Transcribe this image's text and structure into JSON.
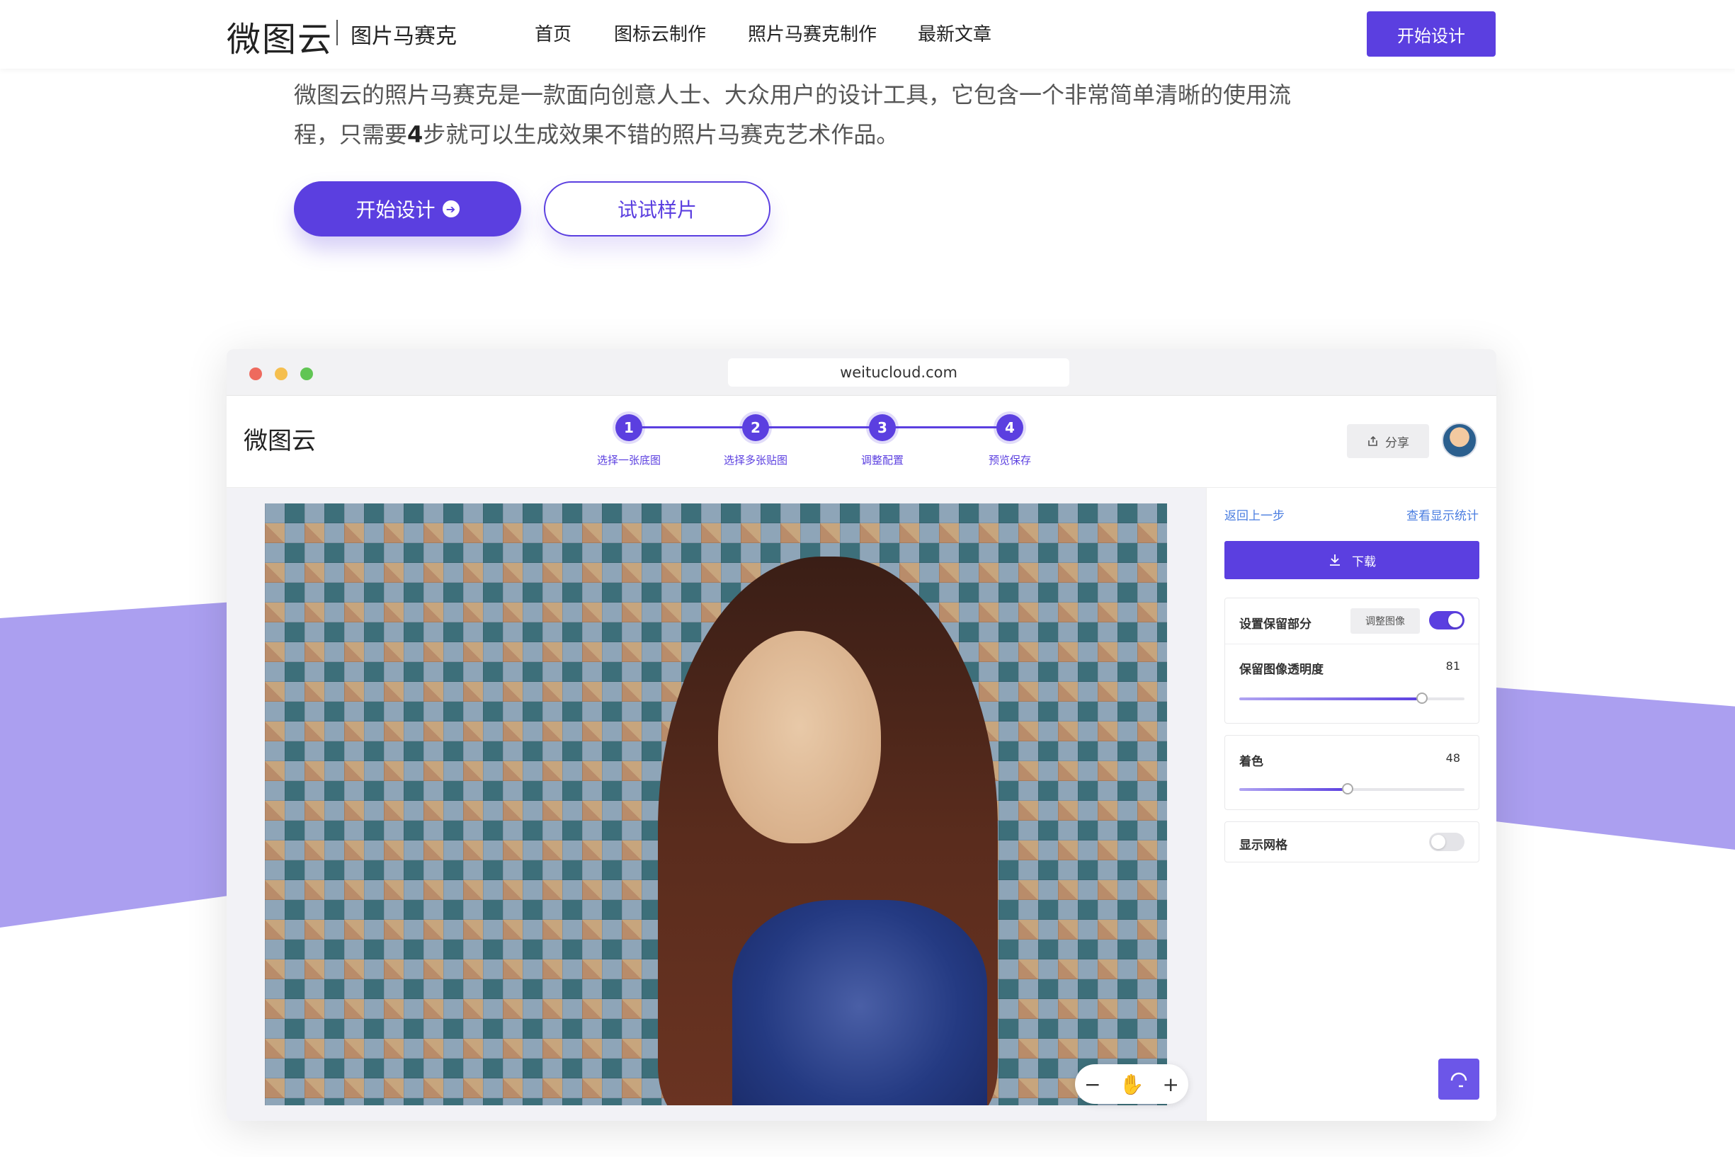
{
  "nav": {
    "brand": "微图云",
    "sub_brand": "图片马赛克",
    "links": [
      "首页",
      "图标云制作",
      "照片马赛克制作",
      "最新文章"
    ],
    "cta": "开始设计"
  },
  "hero": {
    "desc_part1": "微图云的照片马赛克是一款面向创意人士、大众用户的设计工具，它包含一个非常简单清晰的使用流程，只需要",
    "desc_bold": "4",
    "desc_part2": "步就可以生成效果不错的照片马赛克艺术作品。",
    "primary_button": "开始设计",
    "secondary_button": "试试样片"
  },
  "browser": {
    "url": "weitucloud.com",
    "app_logo": "微图云",
    "steps": [
      {
        "num": "1",
        "label": "选择一张底图"
      },
      {
        "num": "2",
        "label": "选择多张贴图"
      },
      {
        "num": "3",
        "label": "调整配置"
      },
      {
        "num": "4",
        "label": "预览保存"
      }
    ],
    "share_label": "分享"
  },
  "panel": {
    "back_link": "返回上一步",
    "stats_link": "查看显示统计",
    "download_label": "下载",
    "keep_part": {
      "label": "设置保留部分",
      "chip": "调整图像",
      "enabled": true
    },
    "opacity": {
      "label": "保留图像透明度",
      "value": "81"
    },
    "tint": {
      "label": "着色",
      "value": "48"
    },
    "grid": {
      "label": "显示网格",
      "enabled": false
    }
  },
  "colors": {
    "accent": "#5b3fe0",
    "decor": "#ab9ff0",
    "link": "#4a7de0"
  }
}
